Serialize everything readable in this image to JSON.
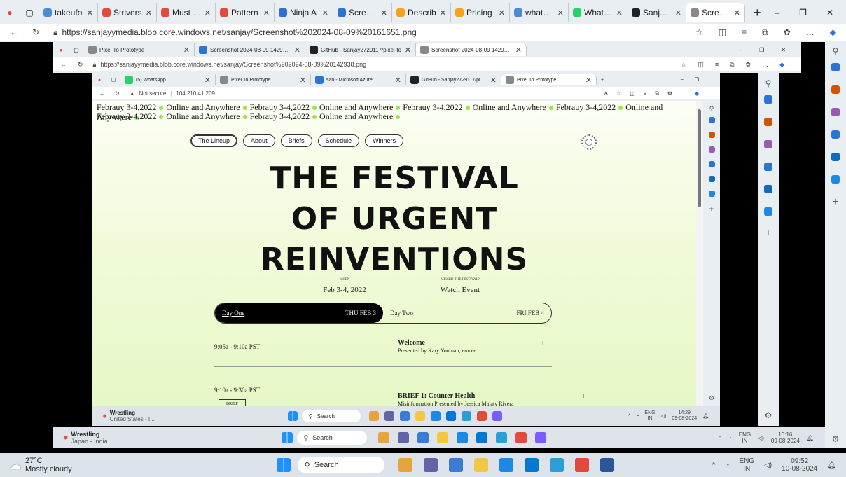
{
  "outer": {
    "tabs": [
      {
        "label": "takeufo",
        "color": "#4a8bd6"
      },
      {
        "label": "Strivers",
        "color": "#e04b3c"
      },
      {
        "label": "Must do",
        "color": "#e04b3c"
      },
      {
        "label": "Pattern",
        "color": "#e04b3c"
      },
      {
        "label": "Ninja A",
        "color": "#2f6fd1"
      },
      {
        "label": "Screens",
        "color": "#2a74d4"
      },
      {
        "label": "Describ",
        "color": "#f6a21a"
      },
      {
        "label": "Pricing",
        "color": "#f6a21a"
      },
      {
        "label": "whatsap",
        "color": "#4a8bd6"
      },
      {
        "label": "WhatsA",
        "color": "#25d366"
      },
      {
        "label": "Sanjay2",
        "color": "#222222"
      },
      {
        "label": "Screens",
        "color": "#888888"
      }
    ],
    "url": "https://sanjayymedia.blob.core.windows.net/sanjay/Screenshot%202024-08-09%20161651.png"
  },
  "mid": {
    "tabs": [
      {
        "label": "Pixel To Prototype",
        "color": "#888888"
      },
      {
        "label": "Screenshot 2024-08-09 142938.p",
        "color": "#2a74d4"
      },
      {
        "label": "GitHub - Sanjay2729117/pixel-to",
        "color": "#222222"
      },
      {
        "label": "Screenshot 2024-08-09 142938.p",
        "color": "#888888"
      }
    ],
    "url": "https://sanjayymedia.blob.core.windows.net/sanjay/Screenshot%202024-08-09%20142938.png"
  },
  "inner": {
    "tabs": [
      {
        "label": "(5) WhatsApp",
        "color": "#25d366"
      },
      {
        "label": "Pixel To Prototype",
        "color": "#888888"
      },
      {
        "label": "san - Microsoft Azure",
        "color": "#2a74d4"
      },
      {
        "label": "GitHub - Sanjay2729117/pixel-to",
        "color": "#222222"
      },
      {
        "label": "Pixel To Prototype",
        "color": "#888888"
      }
    ],
    "not_secure": "Not secure",
    "url": "104.210.41.209"
  },
  "page": {
    "ticker_date": "Febrauy 3-4,2022",
    "ticker_where": "Online and Anywhere",
    "nav": [
      "The Lineup",
      "About",
      "Briefs",
      "Schedule",
      "Winners"
    ],
    "title_lines": [
      "THE FESTIVAL",
      "OF URGENT",
      "REINVENTIONS"
    ],
    "when_label": "WHEN",
    "when_value": "Feb 3-4, 2022",
    "missed_label": "MISSED THE FESTIVAL?",
    "watch_label": "Watch Event",
    "day_one": "Day One",
    "day_one_date": "THU,FEB 3",
    "day_two": "Day Two",
    "day_two_date": "FRI,FEB 4",
    "sessions": [
      {
        "time": "9:05a - 9:10a PST",
        "title": "Welcome",
        "desc": "Presented by Kary Youman, emcee"
      },
      {
        "time": "9:10a - 9:30a PST",
        "title": "BRIEF 1: Counter Health",
        "desc": "Misinformation Presented by Jessica Malaty Rivera",
        "tag": "BRIEF"
      }
    ],
    "plus": "+"
  },
  "taskbars": {
    "inner": {
      "weather": "Wrestling",
      "sub": "United States - I...",
      "search": "Search",
      "lang1": "ENG",
      "lang2": "IN",
      "time": "14:29",
      "date": "09-08-2024"
    },
    "mid": {
      "weather": "Wrestling",
      "sub": "Japan - India",
      "search": "Search",
      "lang1": "ENG",
      "lang2": "IN",
      "time": "16:16",
      "date": "09-08-2024"
    },
    "outer": {
      "weather": "27°C",
      "sub": "Mostly cloudy",
      "search": "Search",
      "lang1": "ENG",
      "lang2": "IN",
      "time": "09:52",
      "date": "10-08-2024"
    }
  }
}
